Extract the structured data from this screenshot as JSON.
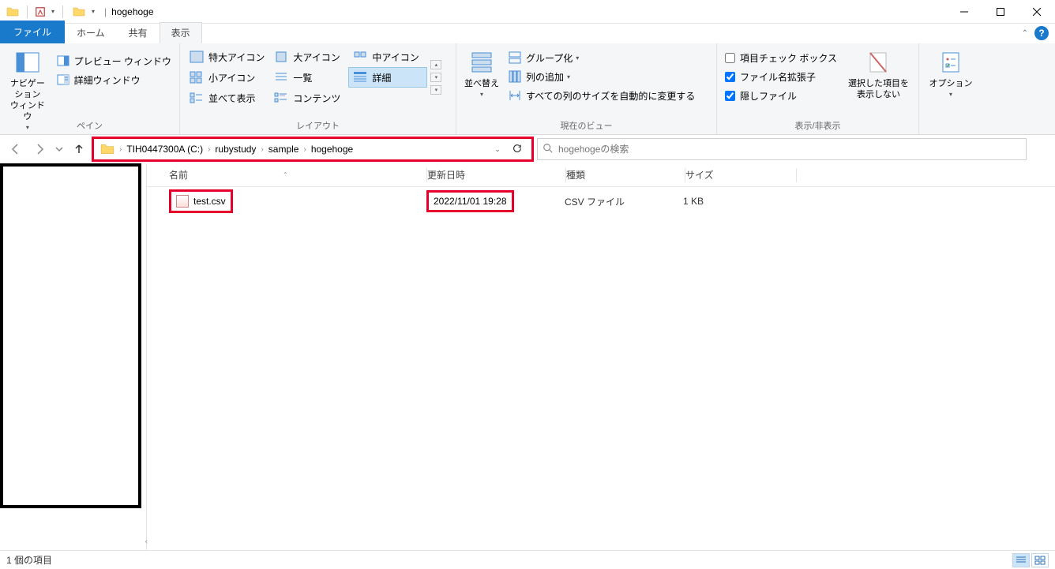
{
  "window": {
    "title": "hogehoge"
  },
  "tabs": {
    "file": "ファイル",
    "home": "ホーム",
    "share": "共有",
    "view": "表示"
  },
  "ribbon": {
    "panes": {
      "label": "ペイン",
      "navigation": "ナビゲーション\nウィンドウ",
      "preview": "プレビュー ウィンドウ",
      "details_pane": "詳細ウィンドウ"
    },
    "layout": {
      "label": "レイアウト",
      "extra_large": "特大アイコン",
      "large": "大アイコン",
      "medium": "中アイコン",
      "small": "小アイコン",
      "list": "一覧",
      "details": "詳細",
      "tiles": "並べて表示",
      "content": "コンテンツ"
    },
    "current_view": {
      "label": "現在のビュー",
      "sort": "並べ替え",
      "group": "グループ化",
      "add_columns": "列の追加",
      "autosize": "すべての列のサイズを自動的に変更する"
    },
    "show_hide": {
      "label": "表示/非表示",
      "checkboxes": "項目チェック ボックス",
      "extensions": "ファイル名拡張子",
      "hidden": "隠しファイル",
      "hide_selected": "選択した項目を\n表示しない"
    },
    "options": {
      "label": "オプション"
    }
  },
  "breadcrumb": {
    "items": [
      "TIH0447300A (C:)",
      "rubystudy",
      "sample",
      "hogehoge"
    ]
  },
  "search": {
    "placeholder": "hogehogeの検索"
  },
  "columns": {
    "name": "名前",
    "date": "更新日時",
    "type": "種類",
    "size": "サイズ"
  },
  "files": [
    {
      "name": "test.csv",
      "date": "2022/11/01 19:28",
      "type": "CSV ファイル",
      "size": "1 KB"
    }
  ],
  "status": {
    "text": "1 個の項目"
  }
}
